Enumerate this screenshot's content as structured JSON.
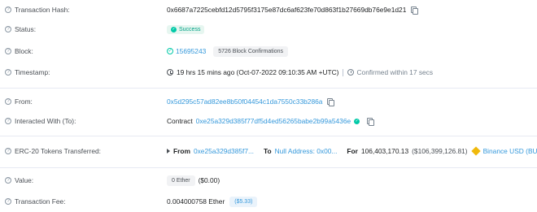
{
  "tx_hash": {
    "label": "Transaction Hash:",
    "value": "0x6687a7225cebfd12d5795f3175e87dc6af623fe70d863f1b27669db76e9e1d21"
  },
  "status": {
    "label": "Status:",
    "value": "Success"
  },
  "block": {
    "label": "Block:",
    "number": "15695243",
    "confirmations": "5726 Block Confirmations"
  },
  "timestamp": {
    "label": "Timestamp:",
    "value": "19 hrs 15 mins ago (Oct-07-2022 09:10:35 AM +UTC)",
    "confirmed": "Confirmed within 17 secs"
  },
  "from": {
    "label": "From:",
    "value": "0x5d295c57ad82ee8b50f04454c1da7550c33b286a"
  },
  "interacted": {
    "label": "Interacted With (To):",
    "prefix": "Contract",
    "value": "0xe25a329d385f77df5d4ed56265babe2b99a5436e"
  },
  "erc20": {
    "label": "ERC-20 Tokens Transferred:",
    "from_label": "From",
    "from_value": "0xe25a329d385f7...",
    "to_label": "To",
    "to_value": "Null Address: 0x00...",
    "for_label": "For",
    "amount": "106,403,170.13",
    "usd": "($106,399,126.81)",
    "token": "Binance USD (BUSD)"
  },
  "value": {
    "label": "Value:",
    "eth": "0 Ether",
    "usd": "($0.00)"
  },
  "fee": {
    "label": "Transaction Fee:",
    "eth": "0.004000758 Ether",
    "usd": "($5.33)"
  },
  "colors": {
    "link": "#3498db",
    "success": "#00c9a7",
    "token": "#f0b90b"
  }
}
